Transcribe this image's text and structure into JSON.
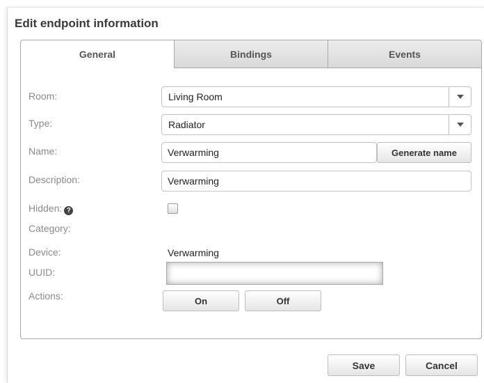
{
  "dialog": {
    "title": "Edit endpoint information"
  },
  "tabs": [
    {
      "label": "General"
    },
    {
      "label": "Bindings"
    },
    {
      "label": "Events"
    }
  ],
  "form": {
    "room": {
      "label": "Room:",
      "value": "Living Room"
    },
    "type": {
      "label": "Type:",
      "value": "Radiator"
    },
    "name": {
      "label": "Name:",
      "value": "Verwarming",
      "button": "Generate name"
    },
    "description": {
      "label": "Description:",
      "value": "Verwarming"
    },
    "hidden": {
      "label": "Hidden:",
      "help_icon": "?",
      "checked": false
    },
    "category": {
      "label": "Category:"
    },
    "device": {
      "label": "Device:",
      "value": "Verwarming"
    },
    "uuid": {
      "label": "UUID:",
      "value": ""
    },
    "actions": {
      "label": "Actions:",
      "buttons": [
        "On",
        "Off"
      ]
    }
  },
  "footer": {
    "save_label": "Save",
    "cancel_label": "Cancel"
  }
}
